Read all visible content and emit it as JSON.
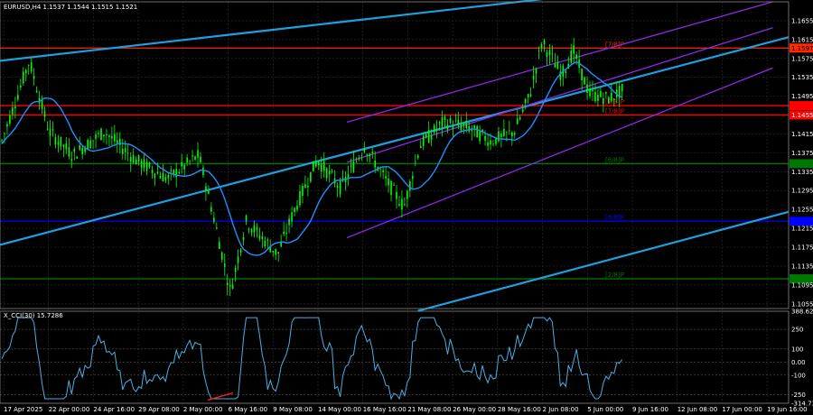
{
  "chart_data": [
    {
      "type": "candlestick",
      "title": "EURUSD,H4  1.1537 1.1544 1.1515 1.1521",
      "ylim": [
        1.1045,
        1.1695
      ],
      "y_ticks": [
        "1.1655",
        "1.1615",
        "1.1575",
        "1.1535",
        "1.1495",
        "1.1455",
        "1.1415",
        "1.1375",
        "1.1335",
        "1.1295",
        "1.1255",
        "1.1215",
        "1.1175",
        "1.1135",
        "1.1095",
        "1.1055"
      ],
      "current_price": "1.1521",
      "price_levels": [
        {
          "label": "[7/8]P",
          "value": 1.1597,
          "value_text": "1.1597",
          "color": "#ff2a00",
          "show_text": true
        },
        {
          "label": "[8/8]P",
          "value": 1.1475,
          "value_text": "1.1475",
          "color": "#ff0000",
          "show_text": false
        },
        {
          "label": "[7/8]P",
          "value": 1.1455,
          "value_text": "1.1455",
          "color": "#ff0000",
          "show_text": false
        },
        {
          "label": "[6/8]P",
          "value": 1.1352,
          "value_text": "1.1352",
          "color": "#007700",
          "show_text": false
        },
        {
          "label": "[4/8]P",
          "value": 1.123,
          "value_text": "1.1230",
          "color": "#0000ff",
          "show_text": false
        },
        {
          "label": "[2/8]P",
          "value": 1.1108,
          "value_text": "1.1108",
          "color": "#007700",
          "show_text": false
        }
      ],
      "trend_lines": [
        {
          "color": "#1e9fe0",
          "from": [
            0,
            1.157
          ],
          "to": [
            1,
            1.176
          ]
        },
        {
          "color": "#1e9fe0",
          "from": [
            0,
            1.118
          ],
          "to": [
            1,
            1.162
          ]
        },
        {
          "color": "#1e9fe0",
          "from": [
            0.53,
            1.104
          ],
          "to": [
            1,
            1.125
          ]
        }
      ],
      "regression_channel": {
        "color": "#8a2be2",
        "lines": [
          {
            "from": [
              0.44,
              1.144
            ],
            "to": [
              0.98,
              1.1695
            ]
          },
          {
            "from": [
              0.44,
              1.1355
            ],
            "to": [
              0.98,
              1.164
            ]
          },
          {
            "from": [
              0.44,
              1.1195
            ],
            "to": [
              0.98,
              1.1555
            ]
          }
        ]
      }
    },
    {
      "type": "line",
      "title": "X_CCI(30) 15.7286",
      "ylim": [
        -314.734,
        388.6237
      ],
      "y_ticks": [
        "388.6237",
        "250",
        "100",
        "0.00",
        "-100",
        "-250",
        "-314.734"
      ],
      "levels": [
        250,
        100,
        0,
        -100,
        -250
      ]
    }
  ],
  "x_ticks": [
    "17 Apr 2025",
    "22 Apr 00:00",
    "24 Apr 16:00",
    "29 Apr 08:00",
    "2 May 00:00",
    "6 May 16:00",
    "9 May 08:00",
    "14 May 00:00",
    "16 May 16:00",
    "21 May 08:00",
    "26 May 00:00",
    "28 May 16:00",
    "2 Jun 08:00",
    "5 Jun 00:00",
    "9 Jun 16:00",
    "12 Jun 08:00",
    "17 Jun 00:00",
    "19 Jun 16:00"
  ],
  "colors": {
    "background": "#000000",
    "candle": "#00ff00",
    "moving_average": "#1e90ff",
    "cci_line": "#4ab0e0",
    "divergence": "#ff2020",
    "axis_text": "#ffffff",
    "grid": "#2e2e2e"
  }
}
